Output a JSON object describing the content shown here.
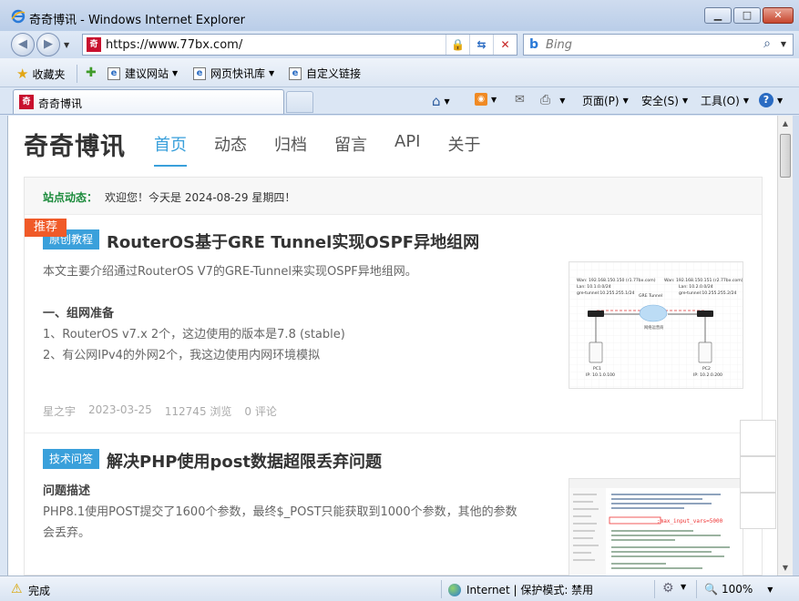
{
  "window": {
    "title": "奇奇博讯 - Windows Internet Explorer",
    "min_glyph": "▁",
    "max_glyph": "□",
    "close_glyph": "✕"
  },
  "address_bar": {
    "url": "https://www.77bx.com/",
    "search_placeholder": "Bing"
  },
  "favorites_bar": {
    "favorites_label": "收藏夹",
    "links": [
      "建议网站",
      "网页快讯库",
      "自定义链接"
    ]
  },
  "tab": {
    "label": "奇奇博讯"
  },
  "command_bar": {
    "page": "页面(P)",
    "safety": "安全(S)",
    "tools": "工具(O)",
    "help": "?"
  },
  "site": {
    "logo": "奇奇博讯",
    "nav": [
      "首页",
      "动态",
      "归档",
      "留言",
      "API",
      "关于"
    ],
    "active_nav": 0,
    "notice_label": "站点动态：",
    "notice_text": "欢迎您！今天是 2024-08-29 星期四！"
  },
  "articles": [
    {
      "ribbon": "推荐",
      "category": "原创教程",
      "title": "RouterOS基于GRE Tunnel实现OSPF异地组网",
      "intro": "本文主要介绍通过RouterOS V7的GRE-Tunnel来实现OSPF异地组网。",
      "section_heading": "一、组网准备",
      "lines": [
        "1、RouterOS v7.x 2个，这边使用的版本是7.8 (stable)",
        "2、有公网IPv4的外网2个，我这边使用内网环境模拟"
      ],
      "author": "星之宇",
      "date": "2023-03-25",
      "views": "112745 浏览",
      "comments": "0 评论",
      "diagram": {
        "left_wan": "Wan: 192.168.150.150 (r1.77bx.com)",
        "left_lan": "Lan: 10.1.0.0/24",
        "left_gre": "gre-tunnel:10.255.255.1/24",
        "right_wan": "Wan: 192.168.150.151 (r2.77bx.com)",
        "right_lan": "Lan: 10.2.0.0/24",
        "right_gre": "gre-tunnel:10.255.255.2/24",
        "tunnel_label": "GRE Tunnel",
        "cloud_label": "网络运营商",
        "pc1": "PC1",
        "pc1_ip": "IP: 10.1.0.100",
        "pc2": "PC2",
        "pc2_ip": "IP: 10.2.0.200"
      }
    },
    {
      "category": "技术问答",
      "title": "解决PHP使用post数据超限丢弃问题",
      "section_heading": "问题描述",
      "lines": [
        "PHP8.1使用POST提交了1600个参数，最终$_POST只能获取到1000个参数，其他的参数",
        "会丢弃。"
      ],
      "code_snippet": ";max_input_vars=5000"
    }
  ],
  "status_bar": {
    "status": "完成",
    "zone": "Internet | 保护模式: 禁用",
    "zoom": "100%"
  },
  "colors": {
    "accent": "#3aa0db",
    "ribbon": "#f05a28",
    "notice_label": "#1a8a3a"
  }
}
